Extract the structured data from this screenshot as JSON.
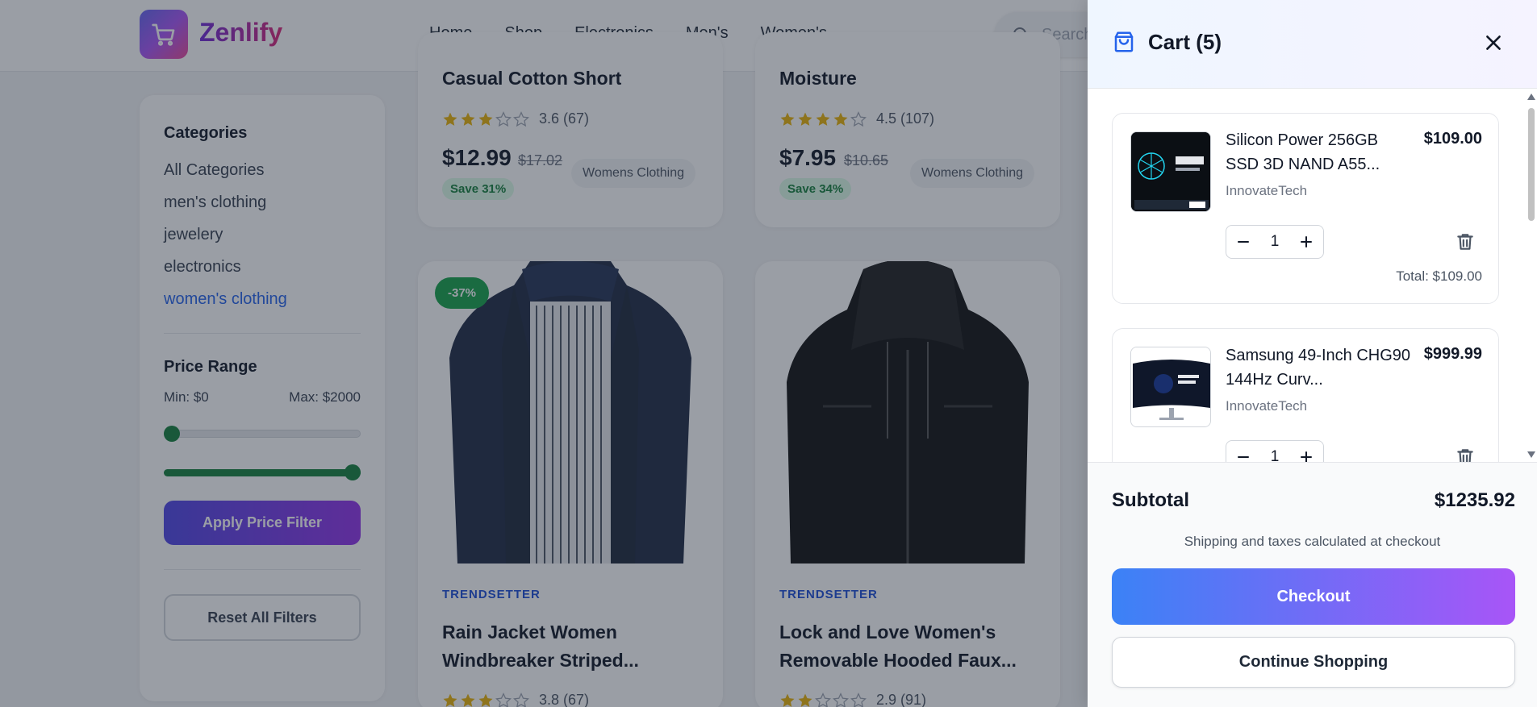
{
  "header": {
    "brand": "Zenlify",
    "nav": [
      "Home",
      "Shop",
      "Electronics",
      "Men's",
      "Women's"
    ],
    "search_placeholder": "Search"
  },
  "sidebar": {
    "categories_title": "Categories",
    "categories": [
      "All Categories",
      "men's clothing",
      "jewelery",
      "electronics",
      "women's clothing"
    ],
    "active_category": "women's clothing",
    "price_title": "Price Range",
    "min_label": "Min: $0",
    "max_label": "Max: $2000",
    "apply_label": "Apply Price Filter",
    "reset_label": "Reset All Filters"
  },
  "products": [
    {
      "title": "Casual Cotton Short",
      "stars": 3,
      "rating": "3.6 (67)",
      "price": "$12.99",
      "old_price": "$17.02",
      "save": "Save 31%",
      "tag": "Womens Clothing"
    },
    {
      "title": "Moisture",
      "stars": 4,
      "rating": "4.5 (107)",
      "price": "$7.95",
      "old_price": "$10.65",
      "save": "Save 34%",
      "tag": "Womens Clothing"
    },
    {
      "discount": "-37%",
      "brand": "TRENDSETTER",
      "title": "Rain Jacket Women Windbreaker Striped...",
      "stars": 3,
      "rating": "3.8 (67)"
    },
    {
      "brand": "TRENDSETTER",
      "title": "Lock and Love Women's Removable Hooded Faux...",
      "stars": 2,
      "rating": "2.9 (91)"
    }
  ],
  "cart": {
    "title": "Cart (5)",
    "items": [
      {
        "name": "Silicon Power 256GB SSD 3D NAND A55...",
        "price": "$109.00",
        "brand": "InnovateTech",
        "qty": "1",
        "total": "Total: $109.00"
      },
      {
        "name": "Samsung 49-Inch CHG90 144Hz Curv...",
        "price": "$999.99",
        "brand": "InnovateTech",
        "qty": "1"
      }
    ],
    "subtotal_label": "Subtotal",
    "subtotal_value": "$1235.92",
    "shipping_note": "Shipping and taxes calculated at checkout",
    "checkout_label": "Checkout",
    "continue_label": "Continue Shopping"
  },
  "colors": {
    "accent_blue": "#2563eb",
    "save_green": "#15803d",
    "discount_green": "#16a34a",
    "gradient_start": "#3b82f6",
    "gradient_end": "#a855f7"
  }
}
